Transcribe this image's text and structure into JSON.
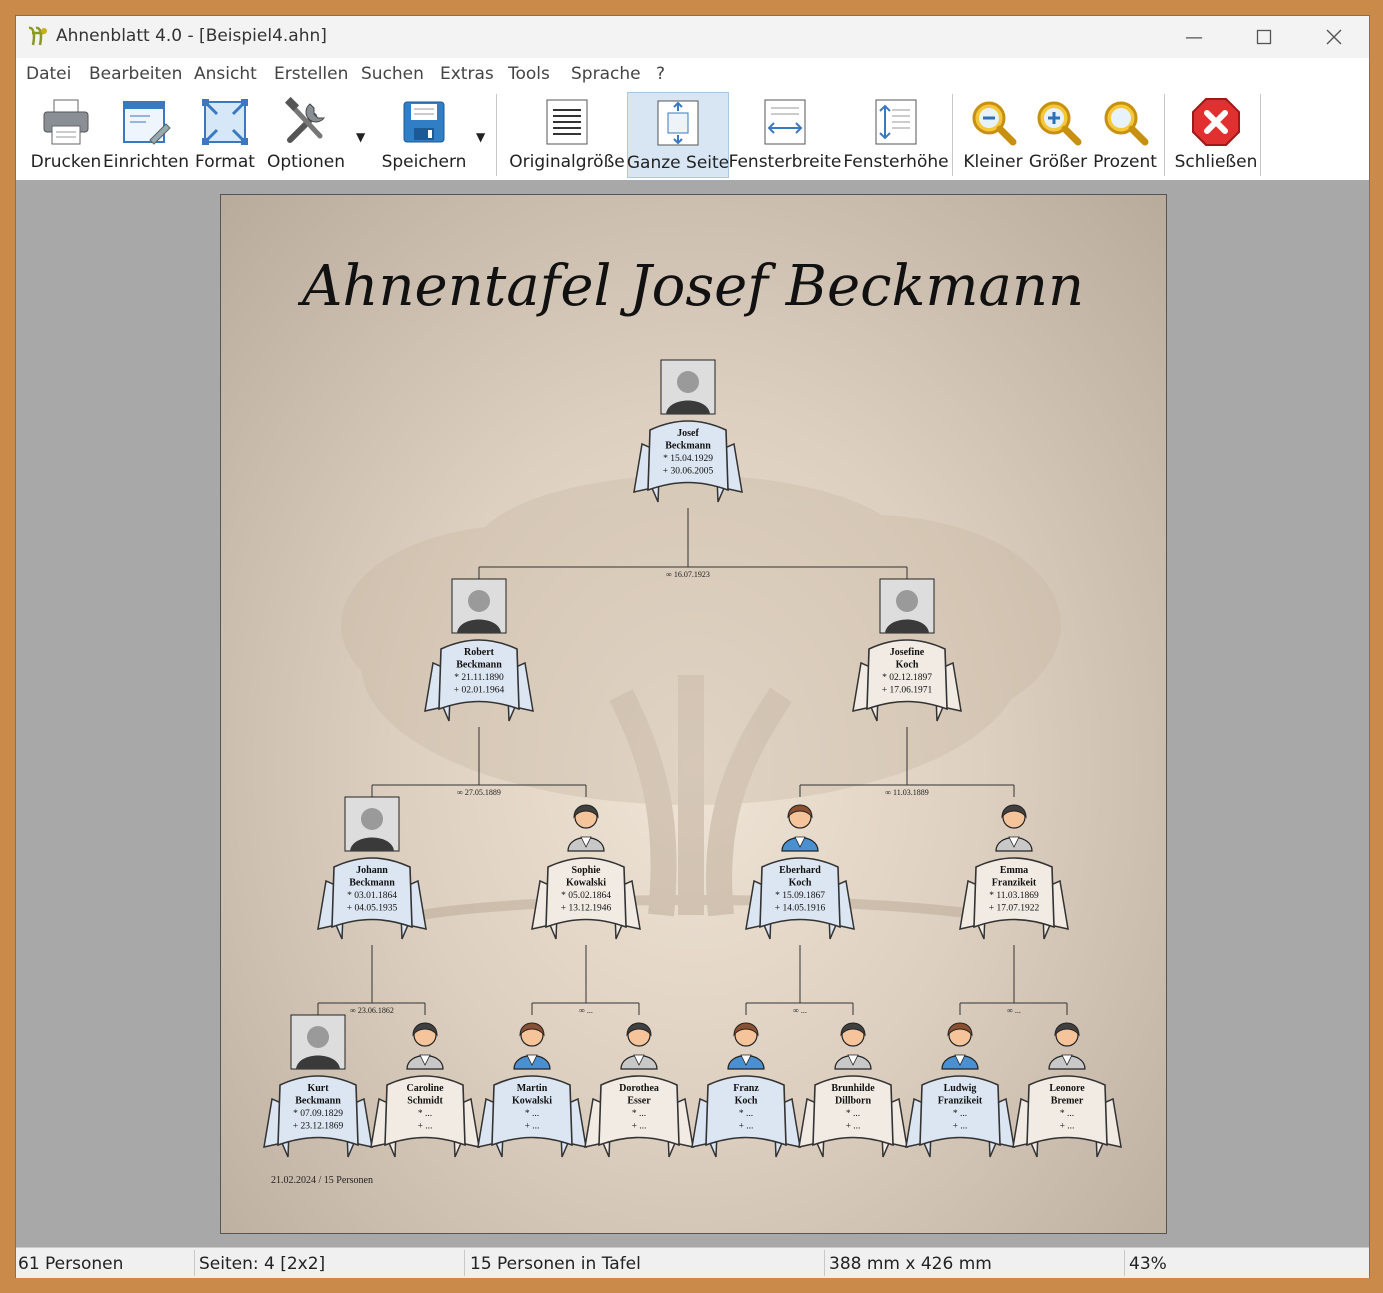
{
  "window": {
    "title": "Ahnenblatt 4.0 - [Beispiel4.ahn]"
  },
  "menu": [
    "Datei",
    "Bearbeiten",
    "Ansicht",
    "Erstellen",
    "Suchen",
    "Extras",
    "Tools",
    "Sprache",
    "?"
  ],
  "toolbar": {
    "drucken": "Drucken",
    "einrichten": "Einrichten",
    "format": "Format",
    "optionen": "Optionen",
    "speichern": "Speichern",
    "originalgroesse": "Originalgröße",
    "ganze_seite": "Ganze Seite",
    "fensterbreite": "Fensterbreite",
    "fensterhoehe": "Fensterhöhe",
    "kleiner": "Kleiner",
    "groesser": "Größer",
    "prozent": "Prozent",
    "schliessen": "Schließen"
  },
  "chart": {
    "title": "Ahnentafel Josef Beckmann",
    "footer": "21.02.2024 / 15 Personen",
    "marriages": {
      "josef_parents": "∞ 16.07.1923",
      "robert_parents": "∞ 27.05.1889",
      "josefine_parents": "∞ 11.03.1889",
      "johann_parents": "∞ 23.06.1862",
      "sophie_parents": "∞ ...",
      "eberhard_parents": "∞ ...",
      "emma_parents": "∞ ..."
    },
    "persons": [
      {
        "first": "Josef",
        "last": "Beckmann",
        "born": "* 15.04.1929",
        "died": "+ 30.06.2005",
        "sex": "m",
        "photo": true
      },
      {
        "first": "Robert",
        "last": "Beckmann",
        "born": "* 21.11.1890",
        "died": "+ 02.01.1964",
        "sex": "m",
        "photo": true
      },
      {
        "first": "Josefine",
        "last": "Koch",
        "born": "* 02.12.1897",
        "died": "+ 17.06.1971",
        "sex": "f",
        "photo": true
      },
      {
        "first": "Johann",
        "last": "Beckmann",
        "born": "* 03.01.1864",
        "died": "+ 04.05.1935",
        "sex": "m",
        "photo": true
      },
      {
        "first": "Sophie",
        "last": "Kowalski",
        "born": "* 05.02.1864",
        "died": "+ 13.12.1946",
        "sex": "f",
        "photo": false
      },
      {
        "first": "Eberhard",
        "last": "Koch",
        "born": "* 15.09.1867",
        "died": "+ 14.05.1916",
        "sex": "m",
        "photo": false
      },
      {
        "first": "Emma",
        "last": "Franzikeit",
        "born": "* 11.03.1869",
        "died": "+ 17.07.1922",
        "sex": "f",
        "photo": false
      },
      {
        "first": "Kurt",
        "last": "Beckmann",
        "born": "* 07.09.1829",
        "died": "+ 23.12.1869",
        "sex": "m",
        "photo": true
      },
      {
        "first": "Caroline",
        "last": "Schmidt",
        "born": "* ...",
        "died": "+ ...",
        "sex": "f",
        "photo": false
      },
      {
        "first": "Martin",
        "last": "Kowalski",
        "born": "* ...",
        "died": "+ ...",
        "sex": "m",
        "photo": false
      },
      {
        "first": "Dorothea",
        "last": "Esser",
        "born": "* ...",
        "died": "+ ...",
        "sex": "f",
        "photo": false
      },
      {
        "first": "Franz",
        "last": "Koch",
        "born": "* ...",
        "died": "+ ...",
        "sex": "m",
        "photo": false
      },
      {
        "first": "Brunhilde",
        "last": "Dillborn",
        "born": "* ...",
        "died": "+ ...",
        "sex": "f",
        "photo": false
      },
      {
        "first": "Ludwig",
        "last": "Franzikeit",
        "born": "* ...",
        "died": "+ ...",
        "sex": "m",
        "photo": false
      },
      {
        "first": "Leonore",
        "last": "Bremer",
        "born": "* ...",
        "died": "+ ...",
        "sex": "f",
        "photo": false
      }
    ]
  },
  "status": {
    "personen": "61 Personen",
    "seiten": "Seiten: 4 [2x2]",
    "in_tafel": "15 Personen in Tafel",
    "groesse": "388 mm x 426 mm",
    "zoom": "43%"
  },
  "colors": {
    "male_banner": "#dbe6f2",
    "female_banner": "#f1ebe3",
    "accent": "#d8e6f3"
  }
}
